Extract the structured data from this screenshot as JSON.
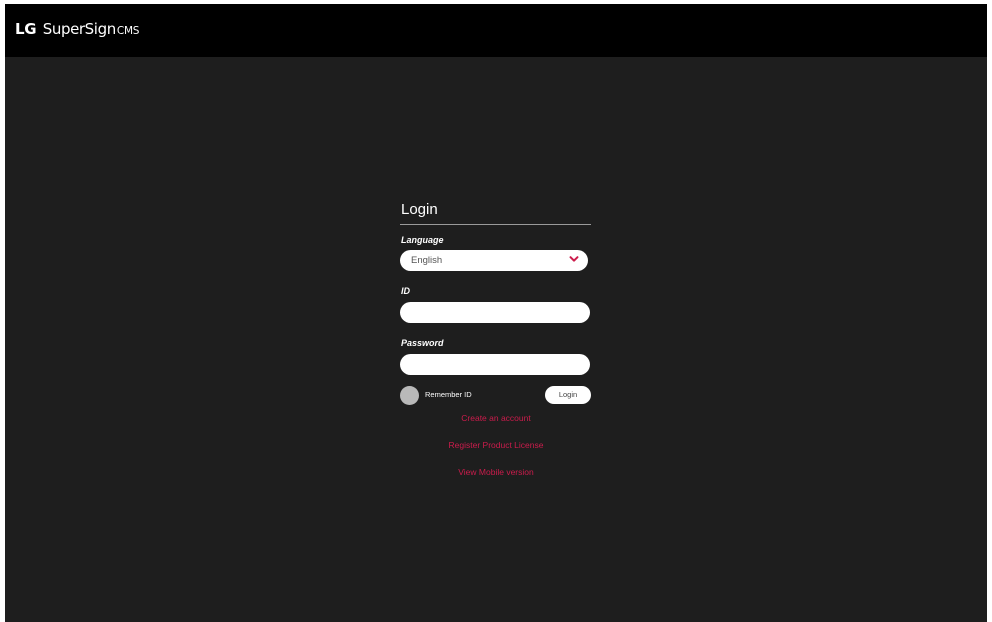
{
  "header": {
    "brand": "LG",
    "product": "SuperSign",
    "suffix": "CMS"
  },
  "login": {
    "title": "Login",
    "language": {
      "label": "Language",
      "value": "English",
      "icon": "chevron-down-icon"
    },
    "id": {
      "label": "ID",
      "value": ""
    },
    "password": {
      "label": "Password",
      "value": ""
    },
    "remember_label": "Remember ID",
    "login_button": "Login",
    "links": {
      "create_account": "Create an account",
      "register_license": "Register Product License",
      "mobile_version": "View Mobile version"
    }
  },
  "colors": {
    "background": "#1e1e1e",
    "header": "#000000",
    "accent": "#cc1c4c",
    "toggle": "#b9b9b9"
  }
}
